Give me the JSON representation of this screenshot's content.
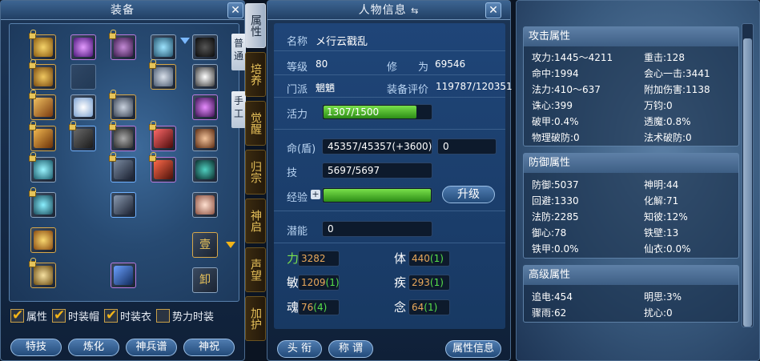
{
  "equipment": {
    "title": "装备",
    "tab_normal": "普通",
    "tab_manual": "手工",
    "checkboxes": [
      {
        "label": "属性",
        "checked": true
      },
      {
        "label": "时装帽",
        "checked": true
      },
      {
        "label": "时装衣",
        "checked": true
      },
      {
        "label": "势力时装",
        "checked": false
      }
    ],
    "buttons": [
      "特技",
      "炼化",
      "神兵谱",
      "神祝"
    ],
    "mini_icons": {
      "seal": "壹",
      "unequip": "卸"
    }
  },
  "side_tabs": [
    "属性",
    "培养",
    "觉醒",
    "归宗",
    "神启",
    "声望",
    "加护"
  ],
  "character": {
    "title": "人物信息",
    "name_label": "名称",
    "name": "メ行云戳乱",
    "level_label": "等级",
    "level": "80",
    "cultivation_label": "修　　为",
    "cultivation": "69546",
    "sect_label": "门派",
    "sect": "魍魉",
    "rating_label": "装备评价",
    "rating": "119787/120351",
    "vigor_label": "活力",
    "vigor": "1307/1500",
    "vigor_fraction": 0.871,
    "life_label": "命(盾)",
    "life": "45357/45357(+3600)",
    "shield": "0",
    "skill_label": "技",
    "skill": "5697/5697",
    "exp_label": "经验",
    "exp_fraction": 1.0,
    "upgrade_button": "升级",
    "potential_label": "潜能",
    "potential": "0",
    "stats": [
      {
        "name": "力",
        "base": "3282",
        "bonus": "",
        "highlight": true
      },
      {
        "name": "体",
        "base": "440",
        "bonus": "(1)",
        "highlight": false
      },
      {
        "name": "敏",
        "base": "1209",
        "bonus": "(1)",
        "highlight": false
      },
      {
        "name": "疾",
        "base": "293",
        "bonus": "(1)",
        "highlight": false
      },
      {
        "name": "魂",
        "base": "76",
        "bonus": "(4)",
        "highlight": false
      },
      {
        "name": "念",
        "base": "64",
        "bonus": "(1)",
        "highlight": false
      }
    ],
    "buttons": {
      "title": "头 衔",
      "nickname": "称 谓",
      "attr_info": "属性信息"
    }
  },
  "attributes": {
    "attack_title": "攻击属性",
    "attack": [
      [
        "攻力:1445～4211",
        "重击:128"
      ],
      [
        "命中:1994",
        "会心一击:3441"
      ],
      [
        "法力:410～637",
        "附加伤害:1138"
      ],
      [
        "诛心:399",
        "万钧:0"
      ],
      [
        "破甲:0.4%",
        "透魔:0.8%"
      ],
      [
        "物理破防:0",
        "法术破防:0"
      ]
    ],
    "defense_title": "防御属性",
    "defense": [
      [
        "防御:5037",
        "神明:44"
      ],
      [
        "回避:1330",
        "化解:71"
      ],
      [
        "法防:2285",
        "知彼:12%"
      ],
      [
        "御心:78",
        "铁壁:13"
      ],
      [
        "铁甲:0.0%",
        "仙衣:0.0%"
      ]
    ],
    "advanced_title": "高级属性",
    "advanced": [
      [
        "追电:454",
        "明思:3%"
      ],
      [
        "骤雨:62",
        "扰心:0"
      ]
    ]
  },
  "colors": {
    "accent_green": "#57e04a",
    "gold": "#e7c15a",
    "orange_value": "#e9a85a"
  }
}
